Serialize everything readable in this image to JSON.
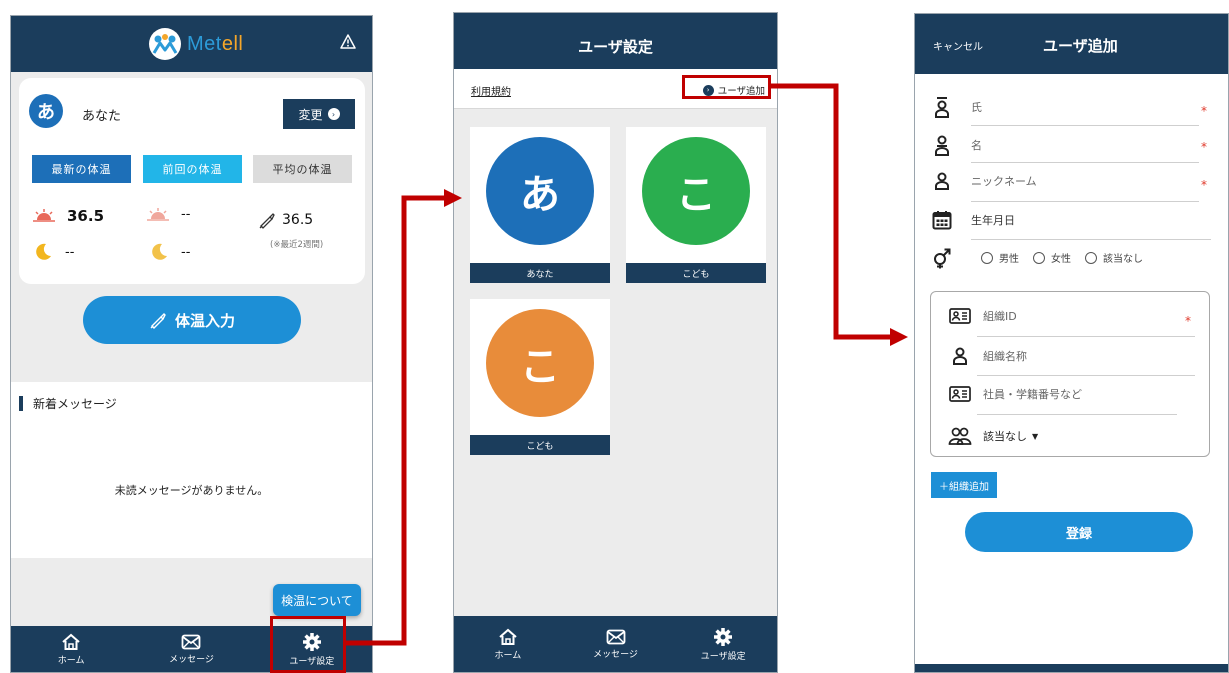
{
  "home": {
    "logo_text_a": "Met",
    "logo_text_b": "ell",
    "user_avatar_char": "あ",
    "user_name": "あなた",
    "change_label": "変更",
    "tabs": [
      "最新の体温",
      "前回の体温",
      "平均の体温"
    ],
    "day_latest": "36.5",
    "night_latest": "--",
    "day_prev": "--",
    "night_prev": "--",
    "avg_value": "36.5",
    "avg_note": "(※最近2週間)",
    "temp_input_label": "体温入力",
    "messages_header": "新着メッセージ",
    "messages_empty": "未読メッセージがありません。",
    "kenon_label": "検温について"
  },
  "nav": {
    "home": "ホーム",
    "messages": "メッセージ",
    "settings": "ユーザ設定"
  },
  "settings": {
    "title": "ユーザ設定",
    "terms": "利用規約",
    "add_user": "ユーザ追加",
    "users": [
      {
        "char": "あ",
        "label": "あなた",
        "color": "#1d6fb8"
      },
      {
        "char": "こ",
        "label": "こども",
        "color": "#2aae4f"
      },
      {
        "char": "こ",
        "label": "こども",
        "color": "#e88c3a"
      }
    ]
  },
  "add": {
    "cancel": "キャンセル",
    "title": "ユーザ追加",
    "last_name": "氏",
    "first_name": "名",
    "nickname": "ニックネーム",
    "birthday": "生年月日",
    "gender_options": [
      "男性",
      "女性",
      "該当なし"
    ],
    "org_id": "組織ID",
    "org_name": "組織名称",
    "member_no": "社員・学籍番号など",
    "group_select": "該当なし",
    "add_org": "＋組織追加",
    "register": "登録",
    "required_mark": "*"
  },
  "colors": {
    "navy": "#1b3d5c",
    "blue": "#1d8fd6",
    "highlight": "#c00000"
  }
}
